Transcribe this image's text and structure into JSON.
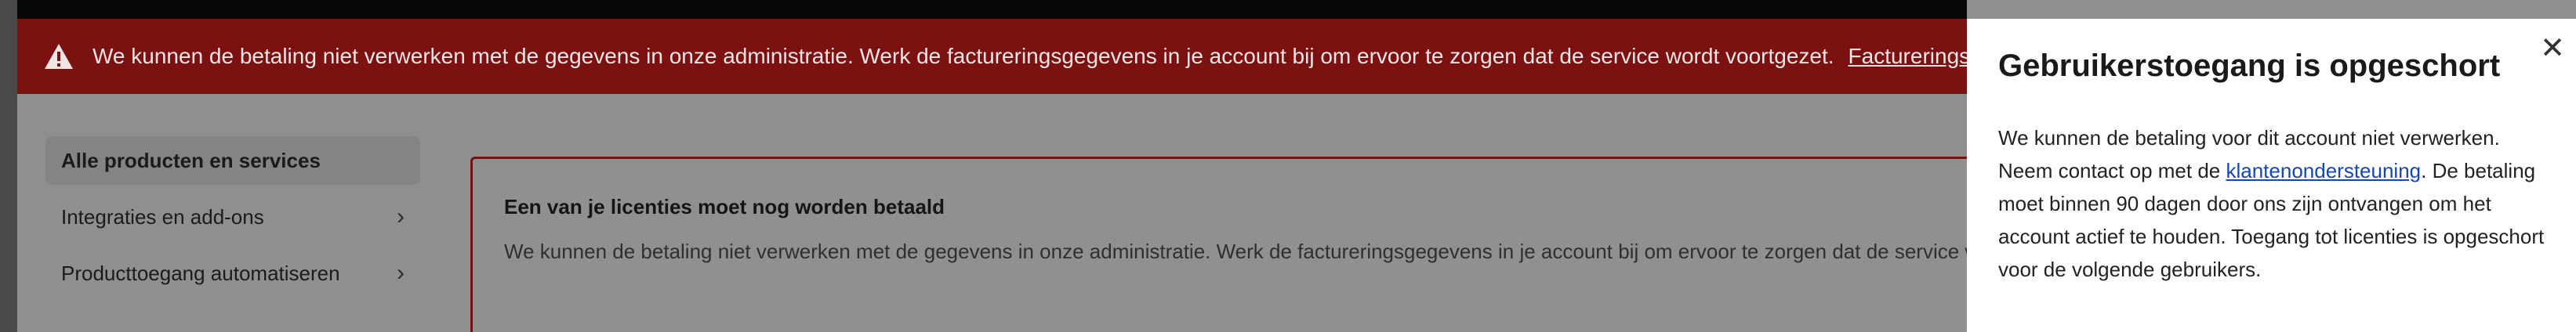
{
  "banner": {
    "icon": "warning-icon",
    "message": "We kunnen de betaling niet verwerken met de gegevens in onze administratie. Werk de factureringsgegevens in je account bij om ervoor te zorgen dat de service wordt voortgezet.",
    "link_label": "Factureringsgegevens bijwerken",
    "bg_color": "#7b1111"
  },
  "sidebar": {
    "items": [
      {
        "label": "Alle producten en services",
        "active": true,
        "chevron": false
      },
      {
        "label": "Integraties en add-ons",
        "active": false,
        "chevron": true
      },
      {
        "label": "Producttoegang automatiseren",
        "active": false,
        "chevron": true
      }
    ]
  },
  "notice": {
    "title": "Een van je licenties moet nog worden betaald",
    "body": "We kunnen de betaling niet verwerken met de gegevens in onze administratie. Werk de factureringsgegevens in je account bij om ervoor te zorgen dat de service wordt voortgezet."
  },
  "drawer": {
    "title": "Gebruikerstoegang is opgeschort",
    "close_icon": "close-icon",
    "text_before_link": "We kunnen de betaling voor dit account niet verwerken. Neem contact op met de ",
    "link_label": "klantenondersteuning",
    "text_after_link": ". De betaling moet binnen 90 dagen door ons zijn ontvangen om het account actief te houden. Toegang tot licenties is opgeschort voor de volgende gebruikers."
  }
}
